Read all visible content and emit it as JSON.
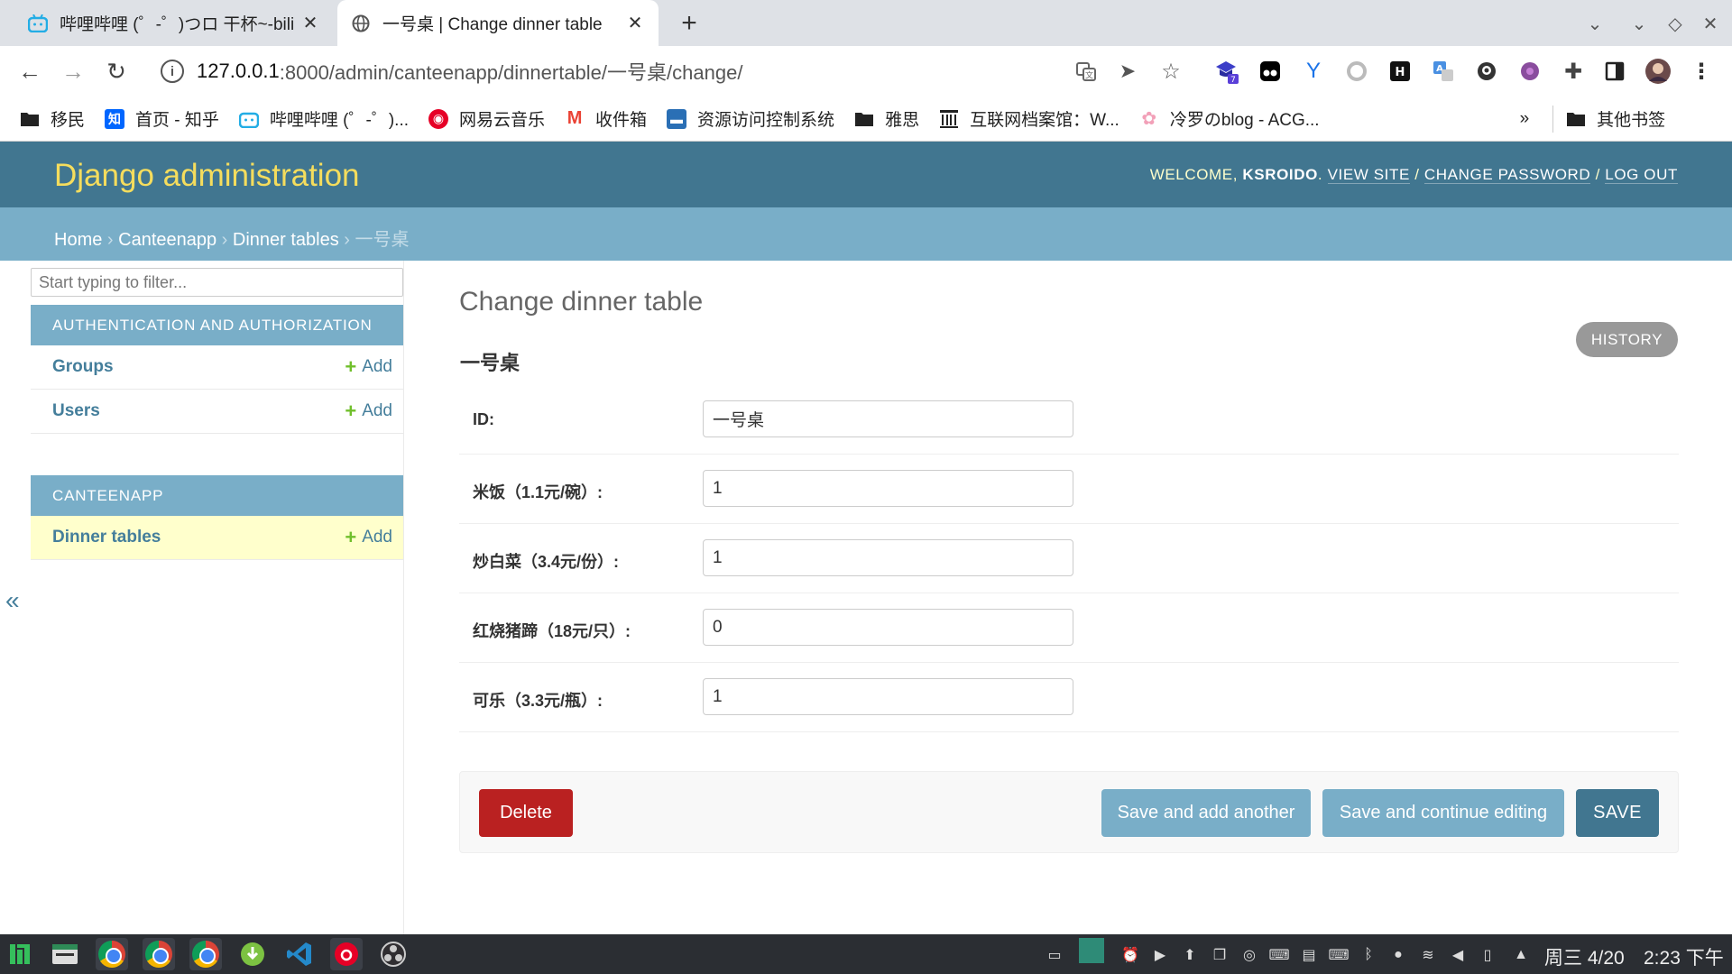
{
  "browser": {
    "tabs": [
      {
        "title": "哔哩哔哩 (゜-゜)つロ 干杯~-bili",
        "active": false
      },
      {
        "title": "一号桌 | Change dinner table",
        "active": true
      }
    ],
    "url": {
      "host": "127.0.0.1",
      "path": ":8000/admin/canteenapp/dinnertable/一号桌/change/"
    },
    "bookmarks": [
      {
        "label": "移民",
        "icon": "folder-icon"
      },
      {
        "label": "首页 - 知乎",
        "icon": "zhihu-icon"
      },
      {
        "label": "哔哩哔哩 (゜-゜)...",
        "icon": "bilibili-icon"
      },
      {
        "label": "网易云音乐",
        "icon": "netease-music-icon"
      },
      {
        "label": "收件箱",
        "icon": "gmail-icon"
      },
      {
        "label": "资源访问控制系统",
        "icon": "site-icon"
      },
      {
        "label": "雅思",
        "icon": "folder-icon"
      },
      {
        "label": "互联网档案馆：W...",
        "icon": "archive-icon"
      },
      {
        "label": "冷罗のblog - ACG...",
        "icon": "blog-icon"
      }
    ],
    "bookmarks_more": "»",
    "other_bookmarks": "其他书签",
    "ext_badge": "7"
  },
  "header": {
    "branding": "Django administration",
    "welcome": "WELCOME, ",
    "username": "KSROIDO",
    "view_site": "VIEW SITE",
    "change_password": "CHANGE PASSWORD",
    "log_out": "LOG OUT",
    "sep": " / ",
    "dot": "."
  },
  "breadcrumbs": {
    "home": "Home",
    "app": "Canteenapp",
    "model": "Dinner tables",
    "current": "一号桌",
    "sep": " › "
  },
  "sidebar": {
    "filter_placeholder": "Start typing to filter...",
    "toggle": "«",
    "modules": [
      {
        "caption": "AUTHENTICATION AND AUTHORIZATION",
        "rows": [
          {
            "name": "Groups",
            "add": "Add"
          },
          {
            "name": "Users",
            "add": "Add"
          }
        ]
      },
      {
        "caption": "CANTEENAPP",
        "rows": [
          {
            "name": "Dinner tables",
            "add": "Add",
            "selected": true
          }
        ]
      }
    ]
  },
  "content": {
    "title": "Change dinner table",
    "history": "HISTORY",
    "object_name": "一号桌",
    "fields": [
      {
        "label": "ID:",
        "value": "一号桌"
      },
      {
        "label": "米饭（1.1元/碗）:",
        "value": "1"
      },
      {
        "label": "炒白菜（3.4元/份）:",
        "value": "1"
      },
      {
        "label": "红烧猪蹄（18元/只）:",
        "value": "0"
      },
      {
        "label": "可乐（3.3元/瓶）:",
        "value": "1"
      }
    ],
    "buttons": {
      "delete": "Delete",
      "save_add_another": "Save and add another",
      "save_continue": "Save and continue editing",
      "save": "SAVE"
    }
  },
  "taskbar": {
    "date": "周三 4/20",
    "time": "2:23 下午"
  },
  "colors": {
    "header_bg": "#417690",
    "breadcrumbs_bg": "#79aec8",
    "brand": "#f5dd5d",
    "delete": "#ba2121",
    "selected_row": "#ffffcc"
  }
}
